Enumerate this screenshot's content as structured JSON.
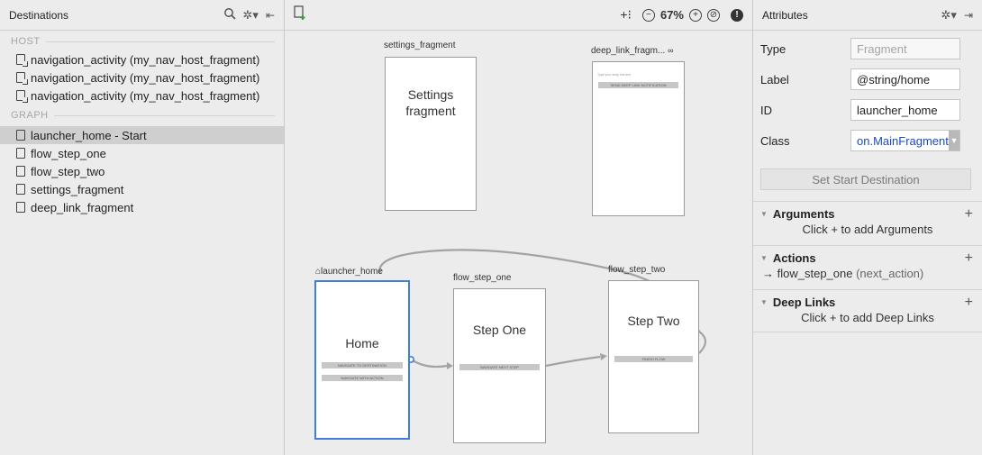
{
  "destinations": {
    "title": "Destinations",
    "host_label": "HOST",
    "host_items": [
      "navigation_activity (my_nav_host_fragment)",
      "navigation_activity (my_nav_host_fragment)",
      "navigation_activity (my_nav_host_fragment)"
    ],
    "graph_label": "GRAPH",
    "graph_items": [
      "launcher_home - Start",
      "flow_step_one",
      "flow_step_two",
      "settings_fragment",
      "deep_link_fragment"
    ],
    "selected_index": 0
  },
  "canvas": {
    "zoom": "67%",
    "fragments": {
      "settings": {
        "label": "settings_fragment",
        "title": "Settings\nfragment"
      },
      "deep_link": {
        "label": "deep_link_fragm...",
        "buttons": [
          "SEND DEEP LINK NOTIFICATION"
        ],
        "input_hint": "Type your deep link text"
      },
      "home": {
        "label": "launcher_home",
        "title": "Home",
        "buttons": [
          "NAVIGATE TO DESTINATION",
          "NAVIGATE WITH ACTION"
        ]
      },
      "step_one": {
        "label": "flow_step_one",
        "title": "Step One",
        "buttons": [
          "NAVIGATE NEXT STEP"
        ]
      },
      "step_two": {
        "label": "flow_step_two",
        "title": "Step Two",
        "buttons": [
          "FINISH FLOW"
        ]
      }
    }
  },
  "attributes": {
    "title": "Attributes",
    "type_label": "Type",
    "type_value": "Fragment",
    "label_label": "Label",
    "label_value": "@string/home",
    "id_label": "ID",
    "id_value": "launcher_home",
    "class_label": "Class",
    "class_value": "on.MainFragment",
    "set_start_label": "Set Start Destination",
    "arguments": {
      "title": "Arguments",
      "hint": "Click + to add Arguments"
    },
    "actions": {
      "title": "Actions",
      "destination": "flow_step_one",
      "action_name": "(next_action)"
    },
    "deep_links": {
      "title": "Deep Links",
      "hint": "Click + to add Deep Links"
    }
  }
}
